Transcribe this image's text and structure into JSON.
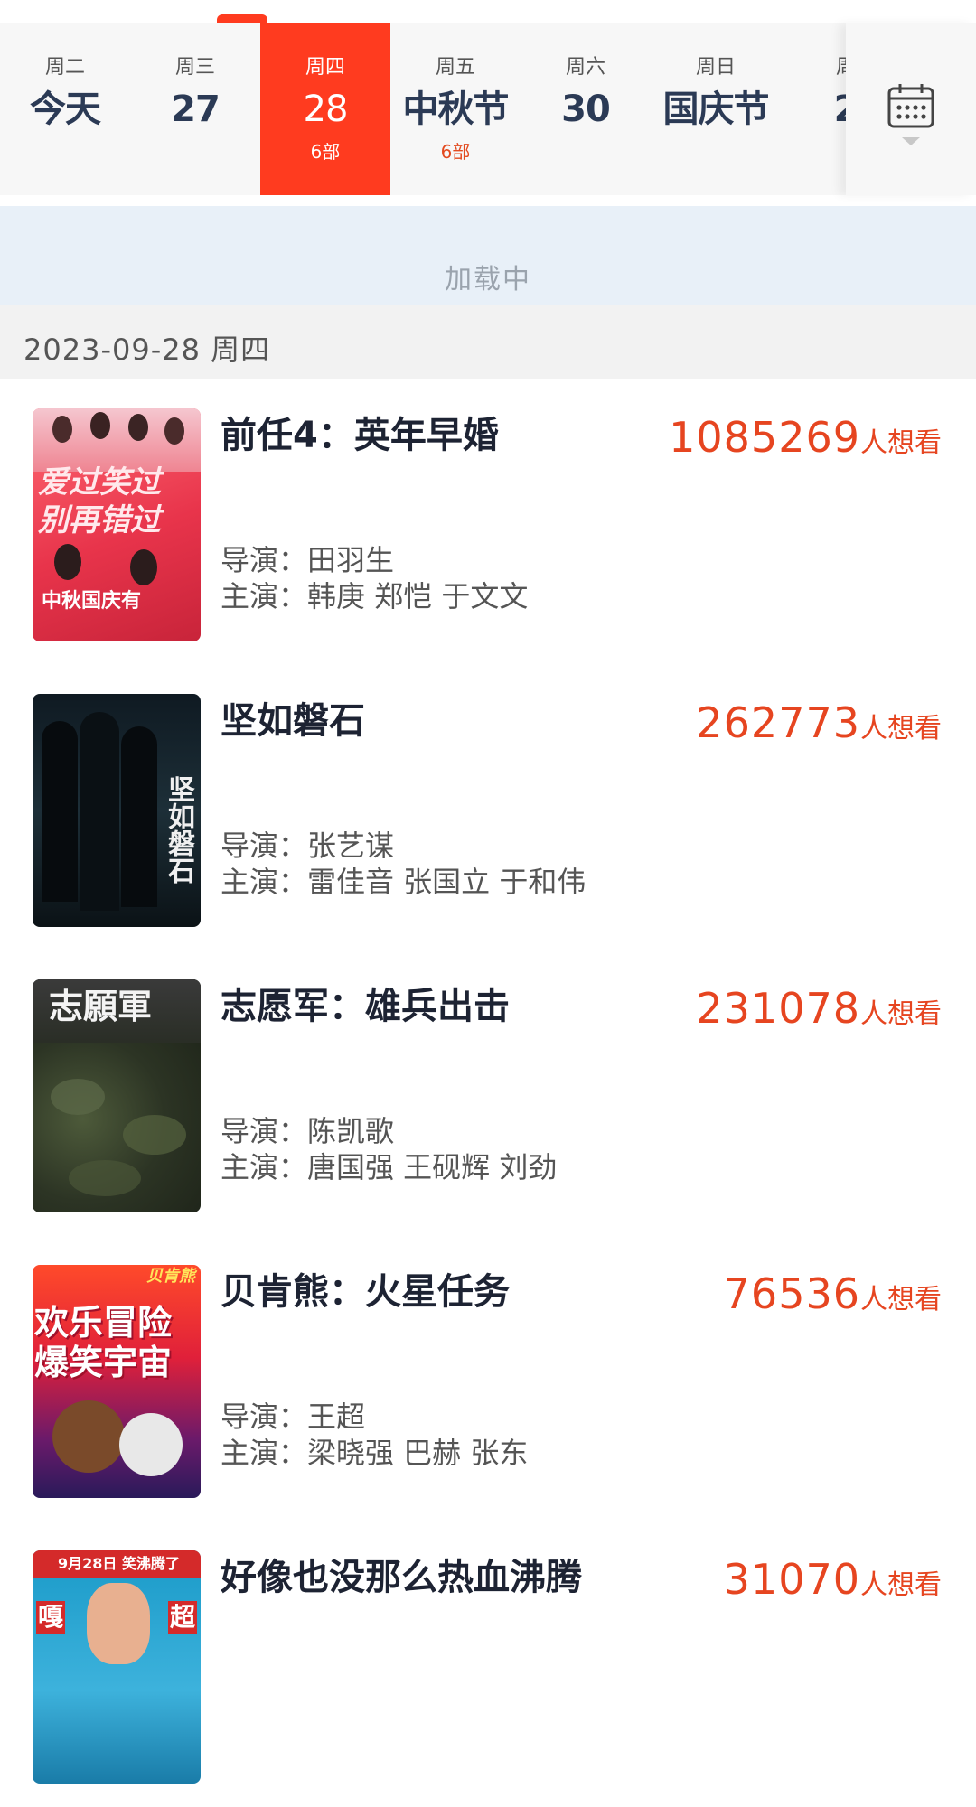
{
  "dates": [
    {
      "weekday": "周二",
      "day": "今天",
      "count": ""
    },
    {
      "weekday": "周三",
      "day": "27",
      "count": ""
    },
    {
      "weekday": "周四",
      "day": "28",
      "count": "6部"
    },
    {
      "weekday": "周五",
      "day": "中秋节",
      "count": "6部"
    },
    {
      "weekday": "周六",
      "day": "30",
      "count": ""
    },
    {
      "weekday": "周日",
      "day": "国庆节",
      "count": ""
    },
    {
      "weekday": "周",
      "day": "2",
      "count": ""
    }
  ],
  "active_index": 2,
  "loading_text": "加载中",
  "date_header": "2023-09-28 周四",
  "want_suffix": "人想看",
  "movies": [
    {
      "title": "前任4：英年早婚",
      "want": "1085269",
      "director": "导演：田羽生",
      "cast": "主演：韩庚 郑恺 于文文",
      "poster_lines": [
        "爱过笑过",
        "别再错过",
        "中秋国庆有"
      ]
    },
    {
      "title": "坚如磐石",
      "want": "262773",
      "director": "导演：张艺谋",
      "cast": "主演：雷佳音 张国立 于和伟",
      "poster_lines": [
        "坚如磐石"
      ]
    },
    {
      "title": "志愿军：雄兵出击",
      "want": "231078",
      "director": "导演：陈凯歌",
      "cast": "主演：唐国强 王砚辉 刘劲",
      "poster_lines": [
        "志願軍"
      ]
    },
    {
      "title": "贝肯熊：火星任务",
      "want": "76536",
      "director": "导演：王超",
      "cast": "主演：梁晓强 巴赫 张东",
      "poster_lines": [
        "贝肯熊",
        "欢乐冒险",
        "爆笑宇宙"
      ]
    },
    {
      "title": "好像也没那么热血沸腾",
      "want": "31070",
      "director": "",
      "cast": "",
      "poster_lines": [
        "9月28日 笑沸腾了",
        "嘎",
        "超"
      ]
    }
  ],
  "colors": {
    "accent": "#ff3b1f",
    "want": "#e64520",
    "title": "#1d2333"
  }
}
